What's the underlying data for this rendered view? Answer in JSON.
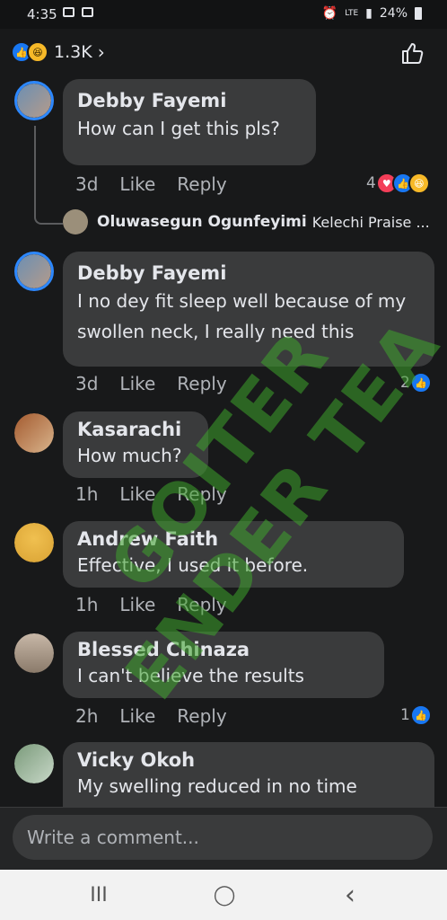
{
  "status": {
    "time": "4:35",
    "battery": "24%",
    "network": "LTE"
  },
  "header": {
    "reaction_count": "1.3K",
    "chevron": "›"
  },
  "watermark": "GOITER ENDER TEA",
  "comments": [
    {
      "name": "Debby Fayemi",
      "text": "How can I get this pls?",
      "time": "3d",
      "like": "Like",
      "reply": "Reply",
      "reactions": "4",
      "avatar_color": "#6b8fb3"
    },
    {
      "name": "Debby Fayemi",
      "text": "I no dey fit sleep well because of my swollen neck, I really need this",
      "time": "3d",
      "like": "Like",
      "reply": "Reply",
      "reactions": "2",
      "avatar_color": "#6b8fb3"
    },
    {
      "name": "Kasarachi",
      "text": "How much?",
      "time": "1h",
      "like": "Like",
      "reply": "Reply",
      "avatar_color": "#a35a2f"
    },
    {
      "name": "Andrew Faith",
      "text": "Effective, I used it before.",
      "time": "1h",
      "like": "Like",
      "reply": "Reply",
      "avatar_color": "#d9a233"
    },
    {
      "name": "Blessed Chinaza",
      "text": "I can't believe the results",
      "time": "2h",
      "like": "Like",
      "reply": "Reply",
      "reactions": "1",
      "avatar_color": "#8a7a6a"
    },
    {
      "name": "Vicky Okoh",
      "text": "My swelling reduced in no time",
      "avatar_color": "#7a9a7a"
    }
  ],
  "reply_preview": {
    "name": "Oluwasegun Ogunfeyimi",
    "text": "Kelechi Praise ..."
  },
  "composer": {
    "placeholder": "Write a comment..."
  },
  "nav": {
    "recent": "III",
    "home": "◯",
    "back": "‹"
  }
}
